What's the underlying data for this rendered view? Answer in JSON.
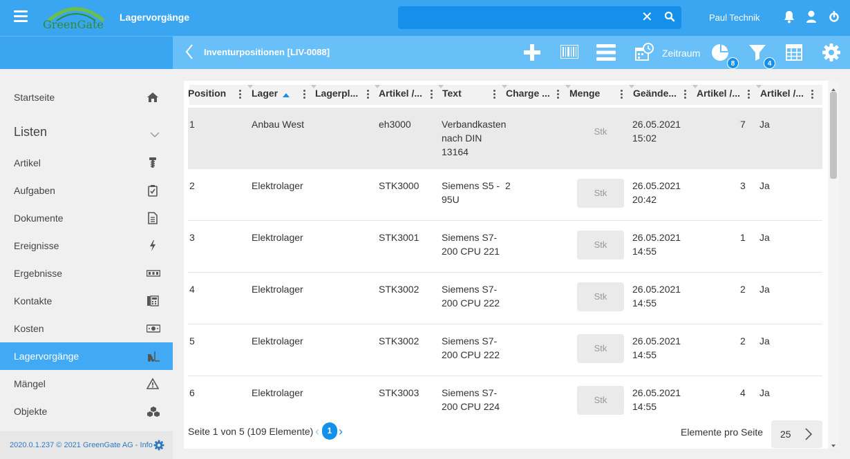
{
  "header": {
    "app_title": "Lagervorgänge",
    "logo_text": "GreenGate",
    "search_placeholder": "",
    "username": "Paul Technik"
  },
  "toolbar": {
    "page_title": "Inventurpositionen [LIV-0088]",
    "zeitraum_label": "Zeitraum",
    "chart_badge": "8",
    "filter_badge": "4"
  },
  "sidebar": {
    "home_label": "Startseite",
    "lists_heading": "Listen",
    "items": [
      {
        "label": "Artikel",
        "icon": "screw-icon"
      },
      {
        "label": "Aufgaben",
        "icon": "clipboard-check-icon"
      },
      {
        "label": "Dokumente",
        "icon": "document-icon"
      },
      {
        "label": "Ereignisse",
        "icon": "lightning-icon"
      },
      {
        "label": "Ergebnisse",
        "icon": "counter-icon"
      },
      {
        "label": "Kontakte",
        "icon": "phone-book-icon"
      },
      {
        "label": "Kosten",
        "icon": "money-icon"
      },
      {
        "label": "Lagervorgänge",
        "icon": "forklift-icon"
      },
      {
        "label": "Mängel",
        "icon": "warning-icon"
      },
      {
        "label": "Objekte",
        "icon": "cubes-icon"
      }
    ],
    "footer": "2020.0.1.237 © 2021 GreenGate AG - Info"
  },
  "table": {
    "columns": [
      "Position",
      "Lager",
      "Lagerpl...",
      "Artikel /...",
      "Text",
      "Charge ...",
      "Menge",
      "Geände...",
      "Artikel /...",
      "Artikel /..."
    ],
    "rows": [
      {
        "position": "1",
        "lager": "Anbau West",
        "lagerplatz": "",
        "artikel": "eh3000",
        "text": [
          "Verbandkasten",
          "nach DIN",
          "13164"
        ],
        "charge": "",
        "menge": "Stk",
        "datum": "26.05.2021",
        "zeit": "15:02",
        "anzahl": "7",
        "flag": "Ja"
      },
      {
        "position": "2",
        "lager": "Elektrolager",
        "lagerplatz": "",
        "artikel": "STK3000",
        "text": [
          "Siemens S5 -",
          "95U"
        ],
        "charge": "2",
        "menge": "Stk",
        "datum": "26.05.2021",
        "zeit": "20:42",
        "anzahl": "3",
        "flag": "Ja"
      },
      {
        "position": "3",
        "lager": "Elektrolager",
        "lagerplatz": "",
        "artikel": "STK3001",
        "text": [
          "Siemens S7-",
          "200 CPU 221"
        ],
        "charge": "",
        "menge": "Stk",
        "datum": "26.05.2021",
        "zeit": "14:55",
        "anzahl": "1",
        "flag": "Ja"
      },
      {
        "position": "4",
        "lager": "Elektrolager",
        "lagerplatz": "",
        "artikel": "STK3002",
        "text": [
          "Siemens S7-",
          "200 CPU 222"
        ],
        "charge": "",
        "menge": "Stk",
        "datum": "26.05.2021",
        "zeit": "14:55",
        "anzahl": "2",
        "flag": "Ja"
      },
      {
        "position": "5",
        "lager": "Elektrolager",
        "lagerplatz": "",
        "artikel": "STK3002",
        "text": [
          "Siemens S7-",
          "200 CPU 222"
        ],
        "charge": "",
        "menge": "Stk",
        "datum": "26.05.2021",
        "zeit": "14:55",
        "anzahl": "2",
        "flag": "Ja"
      },
      {
        "position": "6",
        "lager": "Elektrolager",
        "lagerplatz": "",
        "artikel": "STK3003",
        "text": [
          "Siemens S7-",
          "200 CPU 224"
        ],
        "charge": "",
        "menge": "Stk",
        "datum": "26.05.2021",
        "zeit": "14:55",
        "anzahl": "4",
        "flag": "Ja"
      }
    ]
  },
  "pager": {
    "info": "Seite 1 von 5 (109 Elemente)",
    "current_page": "1",
    "per_page_label": "Elemente pro Seite",
    "per_page_value": "25"
  },
  "colors": {
    "primary": "#3aa6f2",
    "toolbar": "#69bff8",
    "accent": "#1590ea",
    "active_item": "#42aaf4"
  }
}
